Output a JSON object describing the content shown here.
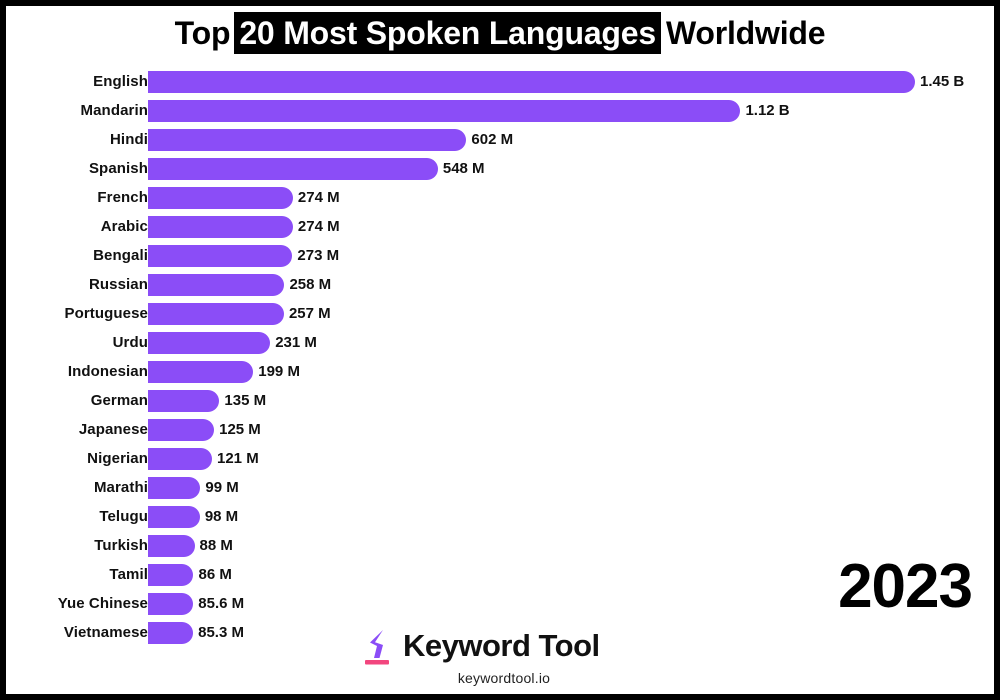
{
  "title": {
    "pre": "Top",
    "highlight": "20 Most Spoken Languages",
    "post": "Worldwide"
  },
  "year": "2023",
  "branding": {
    "logo_icon": "keywordtool-chevron-icon",
    "name": "Keyword Tool",
    "url": "keywordtool.io",
    "logo_color": "#8B4DF7",
    "logo_accent_color": "#F2467E"
  },
  "colors": {
    "bar": "#8B4DF7",
    "text": "#111111",
    "background": "#FFFFFF",
    "frame": "#000000"
  },
  "chart_data": {
    "type": "bar",
    "orientation": "horizontal",
    "title": "Top 20 Most Spoken Languages Worldwide",
    "xlabel": "",
    "ylabel": "",
    "grid": false,
    "legend": null,
    "xlim": [
      0,
      1450
    ],
    "unit": "speakers",
    "categories": [
      "English",
      "Mandarin",
      "Hindi",
      "Spanish",
      "French",
      "Arabic",
      "Bengali",
      "Russian",
      "Portuguese",
      "Urdu",
      "Indonesian",
      "German",
      "Japanese",
      "Nigerian",
      "Marathi",
      "Telugu",
      "Turkish",
      "Tamil",
      "Yue Chinese",
      "Vietnamese"
    ],
    "values": [
      1450,
      1120,
      602,
      548,
      274,
      274,
      273,
      258,
      257,
      231,
      199,
      135,
      125,
      121,
      99,
      98,
      88,
      86,
      85.6,
      85.3
    ],
    "labels": [
      "1.45 B",
      "1.12 B",
      "602 M",
      "548 M",
      "274 M",
      "274 M",
      "273 M",
      "258 M",
      "257 M",
      "231 M",
      "199 M",
      "135 M",
      "125 M",
      "121 M",
      "99 M",
      "98 M",
      "88 M",
      "86 M",
      "85.6 M",
      "85.3 M"
    ]
  }
}
